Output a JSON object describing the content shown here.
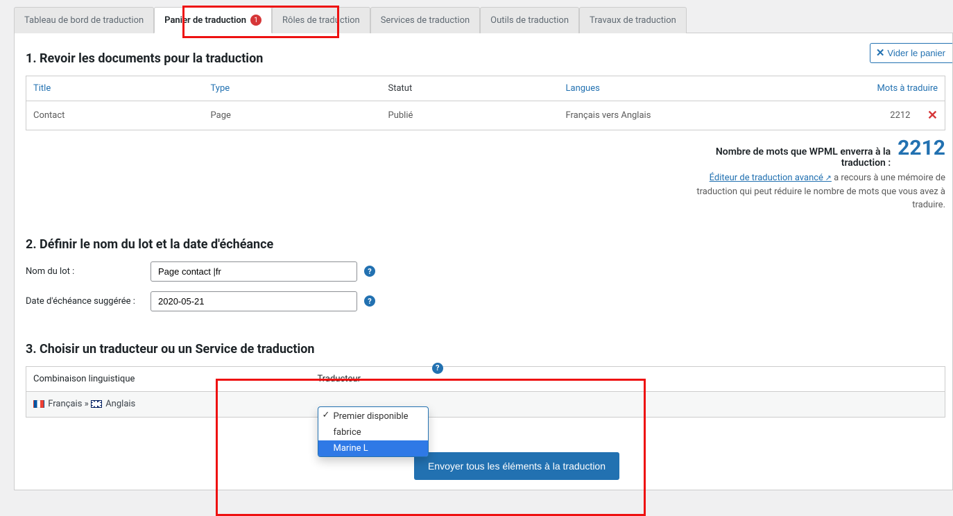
{
  "tabs": [
    {
      "label": "Tableau de bord de traduction"
    },
    {
      "label": "Panier de traduction",
      "badge": "1",
      "active": true
    },
    {
      "label": "Rôles de traduction"
    },
    {
      "label": "Services de traduction"
    },
    {
      "label": "Outils de traduction"
    },
    {
      "label": "Travaux de traduction"
    }
  ],
  "emptyBasket": "Vider le panier",
  "section1": {
    "title": "1. Revoir les documents pour la traduction",
    "headers": {
      "title": "Title",
      "type": "Type",
      "status": "Statut",
      "languages": "Langues",
      "words": "Mots à traduire"
    },
    "row": {
      "title": "Contact",
      "type": "Page",
      "status": "Publié",
      "languages": "Français vers Anglais",
      "words": "2212",
      "remove": "✕"
    },
    "summaryLabel": "Nombre de mots que WPML enverra à la traduction :",
    "summaryValue": "2212",
    "advancedLink": "Éditeur de traduction avancé",
    "noteTail": "a recours à une mémoire de traduction qui peut réduire le nombre de mots que vous avez à traduire."
  },
  "section2": {
    "title": "2. Définir le nom du lot et la date d'échéance",
    "batchLabel": "Nom du lot :",
    "batchValue": "Page contact |fr",
    "dueLabel": "Date d'échéance suggérée :",
    "dueValue": "2020-05-21"
  },
  "section3": {
    "title": "3. Choisir un traducteur ou un Service de traduction",
    "colLang": "Combinaison linguistique",
    "colTranslator": "Traducteur",
    "fromLang": "Français",
    "arrow": "»",
    "toLang": "Anglais",
    "options": [
      "Premier disponible",
      "fabrice",
      "Marine L"
    ],
    "selected": 0,
    "highlighted": 2,
    "submitLabel": "Envoyer tous les éléments à la traduction"
  }
}
